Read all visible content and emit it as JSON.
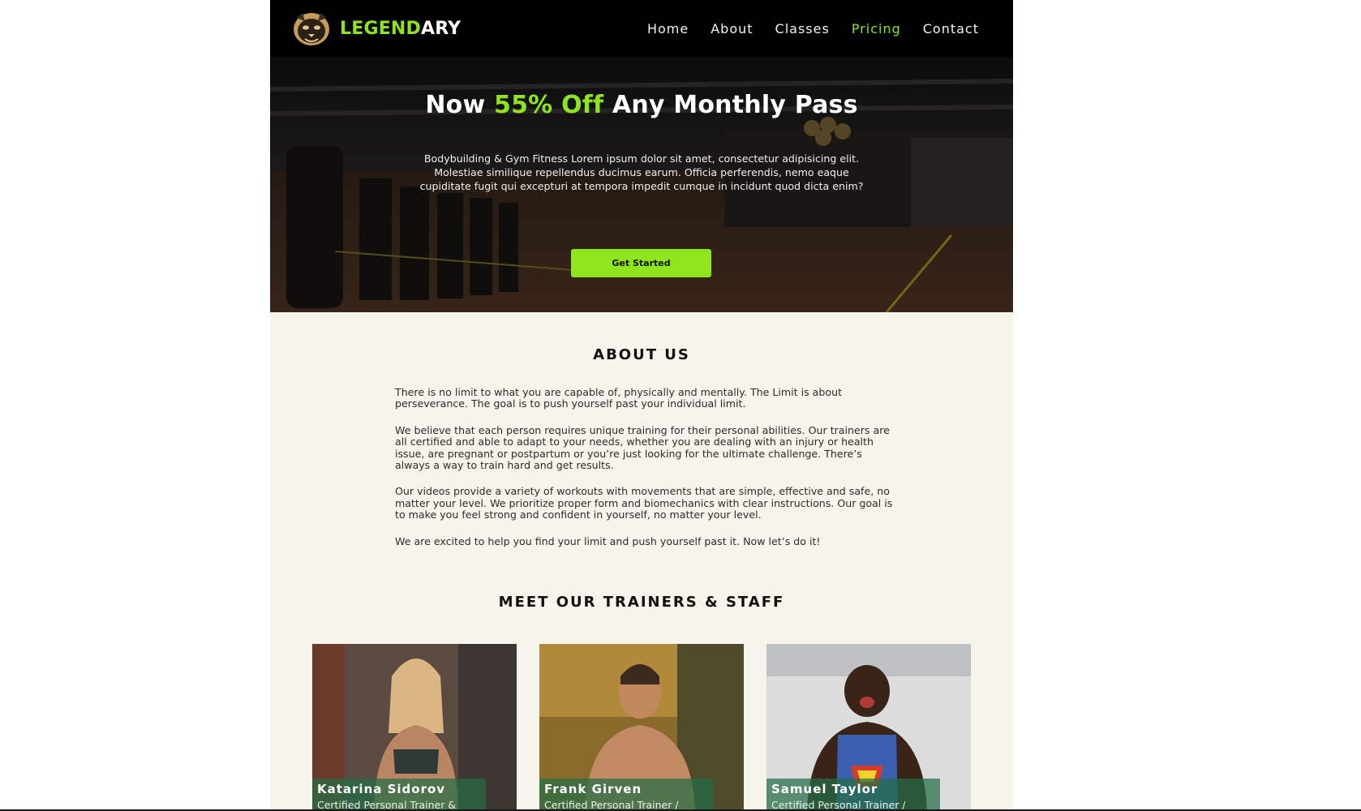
{
  "nav": {
    "brand_part1": "LEGEND",
    "brand_part2": "ARY",
    "logo_icon": "panther-logo-icon",
    "links": [
      {
        "label": "Home",
        "active": false
      },
      {
        "label": "About",
        "active": false
      },
      {
        "label": "Classes",
        "active": false
      },
      {
        "label": "Pricing",
        "active": true
      },
      {
        "label": "Contact",
        "active": false
      }
    ]
  },
  "hero": {
    "title_pre": "Now ",
    "title_accent": "55% Off",
    "title_post": " Any Monthly Pass",
    "text": "Bodybuilding & Gym Fitness Lorem ipsum dolor sit amet, consectetur adipisicing elit. Molestiae similique repellendus ducimus earum. Officia perferendis, nemo eaque cupiditate fugit qui excepturi at tempora impedit cumque in incidunt quod dicta enim?",
    "button": "Get Started"
  },
  "about": {
    "title": "ABOUT US",
    "paragraphs": [
      "There is no limit to what you are capable of, physically and mentally. The Limit is about perseverance. The goal is to push yourself past your individual limit.",
      "We believe that each person requires unique training for their personal abilities. Our trainers are all certified and able to adapt to your needs, whether you are dealing with an injury or health issue, are pregnant or postpartum or you’re just looking for the ultimate challenge. There’s always a way to train hard and get results.",
      "Our videos provide a variety of workouts with movements that are simple, effective and safe, no matter your level. We prioritize proper form and biomechanics with clear instructions. Our goal is to make you feel strong and confident in yourself, no matter your level.",
      "We are excited to help you find your limit and push yourself past it. Now let’s do it!"
    ]
  },
  "trainers": {
    "title": "MEET OUR TRAINERS & STAFF",
    "cards": [
      {
        "name": "Katarina Sidorov",
        "role": "Certified Personal Trainer &"
      },
      {
        "name": "Frank Girven",
        "role": "Certified Personal Trainer /"
      },
      {
        "name": "Samuel Taylor",
        "role": "Certified Personal Trainer /"
      }
    ]
  },
  "colors": {
    "accent": "#8ee51d",
    "nav_bg": "#000000",
    "about_bg": "#f7f4ec"
  }
}
